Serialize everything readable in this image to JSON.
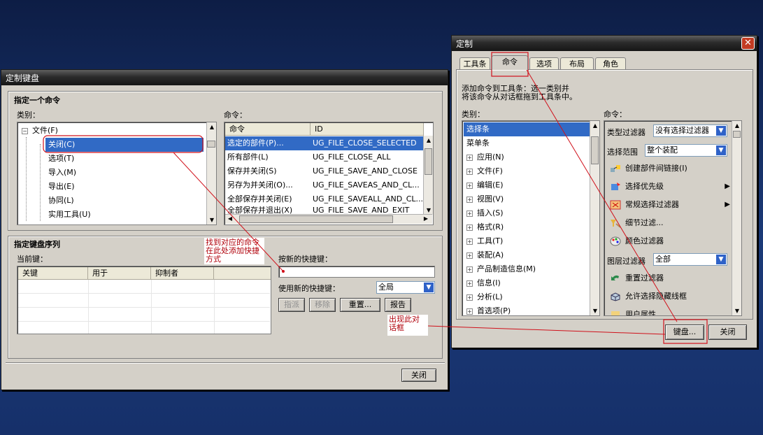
{
  "keyboard_dialog": {
    "title": "定制键盘",
    "section1_title": "指定一个命令",
    "category_label": "类别：",
    "command_label": "命令：",
    "tree_root": "文件(F)",
    "tree_items": [
      "关闭(C)",
      "选项(T)",
      "导入(M)",
      "导出(E)",
      "协同(L)",
      "实用工具(U)",
      "…"
    ],
    "cmd_columns": [
      "命令",
      "ID"
    ],
    "cmd_rows": [
      {
        "name": "选定的部件(P)...",
        "id": "UG_FILE_CLOSE_SELECTED"
      },
      {
        "name": "所有部件(L)",
        "id": "UG_FILE_CLOSE_ALL"
      },
      {
        "name": "保存并关闭(S)",
        "id": "UG_FILE_SAVE_AND_CLOSE"
      },
      {
        "name": "另存为并关闭(O)...",
        "id": "UG_FILE_SAVEAS_AND_CL..."
      },
      {
        "name": "全部保存并关闭(E)",
        "id": "UG_FILE_SAVEALL_AND_CL..."
      },
      {
        "name": "全部保存并退出(X)",
        "id": "UG_FILE_SAVE_AND_EXIT"
      }
    ],
    "section2_title": "指定键盘序列",
    "current_keys_label": "当前键：",
    "keys_columns": [
      "关键",
      "用于",
      "抑制者"
    ],
    "new_shortcut_label": "按新的快捷键：",
    "new_shortcut_value": "",
    "use_new_label": "使用新的快捷键：",
    "use_new_value": "全局",
    "buttons": {
      "assign": "指派",
      "remove": "移除",
      "reset": "重置...",
      "report": "报告",
      "close": "关闭"
    }
  },
  "customize_dialog": {
    "title": "定制",
    "tabs": [
      "工具条",
      "命令",
      "选项",
      "布局",
      "角色"
    ],
    "active_tab": "命令",
    "instructions_line1": "添加命令到工具条：选一类别并",
    "instructions_line2": "将该命令从对话框拖到工具条中。",
    "category_label": "类别：",
    "command_label": "命令：",
    "categories": [
      {
        "label": "选择条",
        "expandable": false,
        "selected": true
      },
      {
        "label": "菜单条",
        "expandable": false
      },
      {
        "label": "应用(N)",
        "expandable": true
      },
      {
        "label": "文件(F)",
        "expandable": true
      },
      {
        "label": "编辑(E)",
        "expandable": true
      },
      {
        "label": "视图(V)",
        "expandable": true
      },
      {
        "label": "插入(S)",
        "expandable": true
      },
      {
        "label": "格式(R)",
        "expandable": true
      },
      {
        "label": "工具(T)",
        "expandable": true
      },
      {
        "label": "装配(A)",
        "expandable": true
      },
      {
        "label": "产品制造信息(M)",
        "expandable": true
      },
      {
        "label": "信息(I)",
        "expandable": true
      },
      {
        "label": "分析(L)",
        "expandable": true
      },
      {
        "label": "首选项(P)",
        "expandable": true
      }
    ],
    "type_filter_label": "类型过滤器",
    "type_filter_value": "没有选择过滤器",
    "scope_label": "选择范围",
    "scope_value": "整个装配",
    "commands": [
      {
        "label": "创建部件间链接(I)",
        "icon": "link-icon"
      },
      {
        "label": "选择优先级",
        "icon": "priority-icon",
        "submenu": true
      },
      {
        "label": "常规选择过滤器",
        "icon": "filter-icon",
        "submenu": true
      },
      {
        "label": "细节过滤...",
        "icon": "detail-filter-icon"
      },
      {
        "label": "颜色过滤器",
        "icon": "palette-icon"
      }
    ],
    "layer_filter_label": "图层过滤器",
    "layer_filter_value": "全部",
    "commands2": [
      {
        "label": "重置过滤器",
        "icon": "reset-arrow-icon"
      },
      {
        "label": "允许选择隐藏线框",
        "icon": "wireframe-icon"
      },
      {
        "label": "用户属性",
        "icon": "user-attr-icon"
      }
    ],
    "buttons": {
      "keyboard": "键盘...",
      "close": "关闭"
    }
  },
  "annotations": {
    "note1": [
      "找到对应的命令",
      "在此处添加快捷",
      "方式"
    ],
    "note2": [
      "出现此对",
      "话框"
    ]
  },
  "colors": {
    "annotation": "#d0101a",
    "selection": "#316ac5",
    "desktop": "#1b3a78"
  }
}
